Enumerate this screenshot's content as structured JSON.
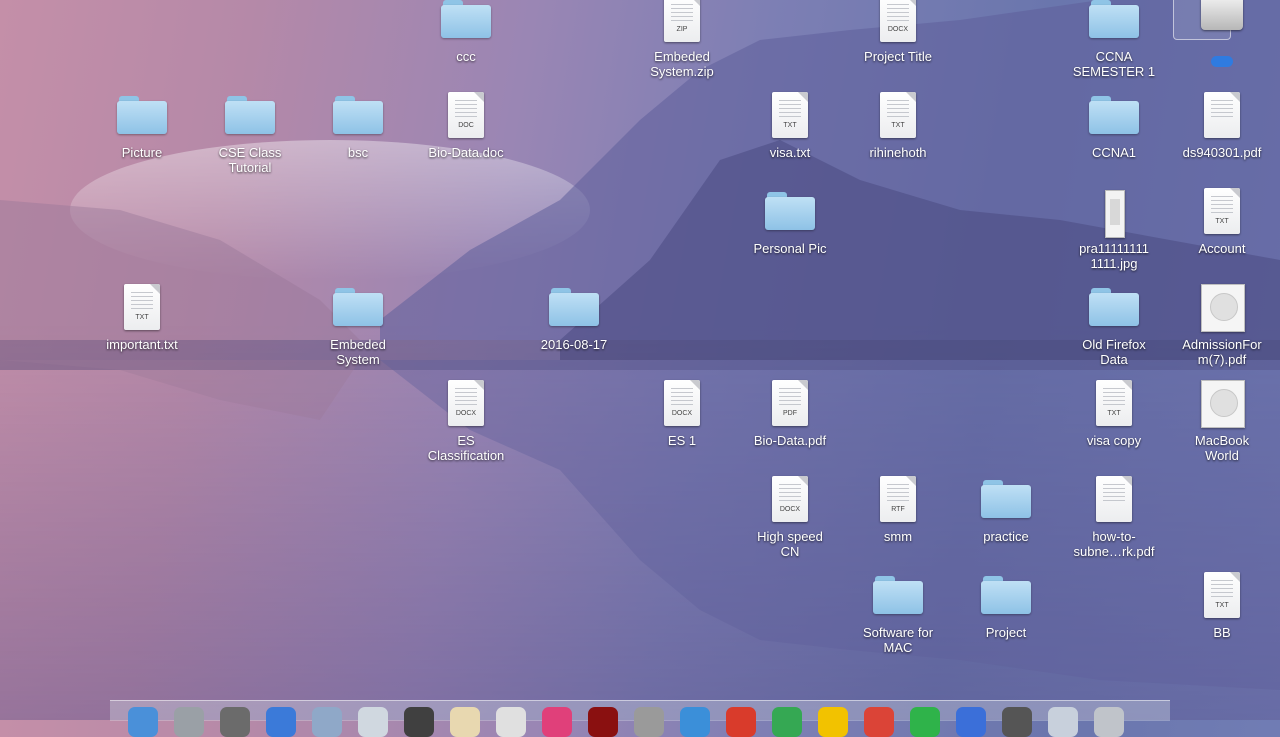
{
  "desktop": {
    "icons": {
      "ccc": {
        "label": "ccc",
        "kind": "folder"
      },
      "embeded_system_zip": {
        "label": "Embeded\nSystem.zip",
        "kind": "doc",
        "ext": "ZIP"
      },
      "project_title": {
        "label": "Project Title",
        "kind": "doc",
        "ext": "DOCX"
      },
      "ccna_semester_1": {
        "label": "CCNA\nSEMESTER 1",
        "kind": "folder"
      },
      "drive": {
        "label": "",
        "kind": "drive"
      },
      "picture": {
        "label": "Picture",
        "kind": "folder"
      },
      "cse_class_tutorial": {
        "label": "CSE Class\nTutorial",
        "kind": "folder"
      },
      "bsc": {
        "label": "bsc",
        "kind": "folder"
      },
      "bio_data_doc": {
        "label": "Bio-Data.doc",
        "kind": "doc",
        "ext": "DOC"
      },
      "visa_txt": {
        "label": "visa.txt",
        "kind": "doc",
        "ext": "TXT"
      },
      "rihinehoth": {
        "label": "rihinehoth",
        "kind": "doc",
        "ext": "TXT"
      },
      "ccna1": {
        "label": "CCNA1",
        "kind": "folder"
      },
      "ds940301_pdf": {
        "label": "ds940301.pdf",
        "kind": "doc",
        "ext": ""
      },
      "personal_pic": {
        "label": "Personal Pic",
        "kind": "folder"
      },
      "pra_jpg": {
        "label": "pra11111111\n1111.jpg",
        "kind": "image"
      },
      "account": {
        "label": "Account",
        "kind": "doc",
        "ext": "TXT"
      },
      "important_txt": {
        "label": "important.txt",
        "kind": "doc",
        "ext": "TXT"
      },
      "embeded_system": {
        "label": "Embeded\nSystem",
        "kind": "folder"
      },
      "date_folder": {
        "label": "2016-08-17",
        "kind": "folder"
      },
      "old_firefox_data": {
        "label": "Old Firefox\nData",
        "kind": "folder"
      },
      "admission_form": {
        "label": "AdmissionFor\nm(7).pdf",
        "kind": "thumb"
      },
      "es_classification": {
        "label": "ES\nClassification",
        "kind": "doc",
        "ext": "DOCX"
      },
      "es_1": {
        "label": "ES 1",
        "kind": "doc",
        "ext": "DOCX"
      },
      "bio_data_pdf": {
        "label": "Bio-Data.pdf",
        "kind": "doc",
        "ext": "PDF"
      },
      "visa_copy": {
        "label": "visa copy",
        "kind": "doc",
        "ext": "TXT"
      },
      "macbook_world": {
        "label": "MacBook\nWorld",
        "kind": "thumb"
      },
      "high_speed_cn": {
        "label": "High speed\nCN",
        "kind": "doc",
        "ext": "DOCX"
      },
      "smm": {
        "label": "smm",
        "kind": "doc",
        "ext": "RTF"
      },
      "practice": {
        "label": "practice",
        "kind": "folder"
      },
      "how_to_subnet": {
        "label": "how-to-\nsubne…rk.pdf",
        "kind": "doc",
        "ext": ""
      },
      "software_for_mac": {
        "label": "Software for\nMAC",
        "kind": "folder"
      },
      "project": {
        "label": "Project",
        "kind": "folder"
      },
      "bb": {
        "label": "BB",
        "kind": "doc",
        "ext": "TXT"
      }
    }
  },
  "dock": {
    "apps": [
      {
        "name": "finder",
        "color": "#4a90d9"
      },
      {
        "name": "launchpad",
        "color": "#9aa0a6"
      },
      {
        "name": "app",
        "color": "#6b6b6b"
      },
      {
        "name": "app-store",
        "color": "#3b7ad9"
      },
      {
        "name": "app",
        "color": "#8fa8c8"
      },
      {
        "name": "safari",
        "color": "#d0d8e0"
      },
      {
        "name": "app",
        "color": "#404040"
      },
      {
        "name": "app",
        "color": "#e8d8b0"
      },
      {
        "name": "calendar",
        "color": "#e0e0e0"
      },
      {
        "name": "itunes",
        "color": "#e0407a"
      },
      {
        "name": "app",
        "color": "#8a1010"
      },
      {
        "name": "system-preferences",
        "color": "#9a9a9a"
      },
      {
        "name": "app",
        "color": "#3b8fd9"
      },
      {
        "name": "app",
        "color": "#d93b2b"
      },
      {
        "name": "app",
        "color": "#35a853"
      },
      {
        "name": "app",
        "color": "#f2c200"
      },
      {
        "name": "chrome",
        "color": "#db4437"
      },
      {
        "name": "app",
        "color": "#2fb34a"
      },
      {
        "name": "app",
        "color": "#3b6fd9"
      },
      {
        "name": "app",
        "color": "#555555"
      },
      {
        "name": "app",
        "color": "#c8d0dc"
      },
      {
        "name": "trash",
        "color": "#c0c4ca"
      }
    ]
  }
}
